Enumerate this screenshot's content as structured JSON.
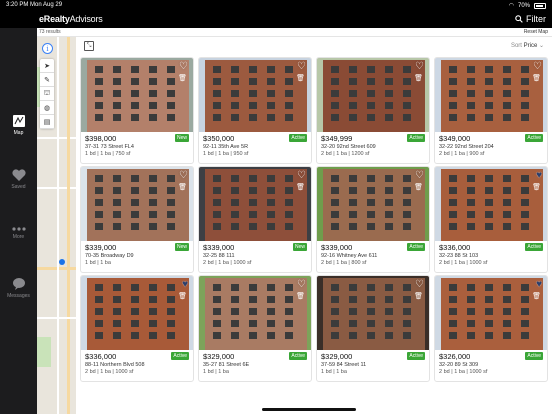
{
  "status": {
    "time": "3:20 PM",
    "date": "Mon Aug 29",
    "battery": "70%"
  },
  "header": {
    "logo_brand": "eRealty",
    "logo_rest": "Advisors",
    "filter_label": "Filter"
  },
  "rail": [
    {
      "label": "Map",
      "icon": "map-icon",
      "active": true
    },
    {
      "label": "Saved",
      "icon": "heart-icon",
      "active": false
    },
    {
      "label": "More",
      "icon": "more-dots-icon",
      "active": false
    },
    {
      "label": "Messages",
      "icon": "chat-bubble-icon",
      "active": false
    }
  ],
  "subheader": {
    "results": "73 results",
    "reset": "Reset Map"
  },
  "sort": {
    "label": "Sort",
    "value": "Price"
  },
  "listings": [
    {
      "price": "$398,000",
      "address": "37-31 73 Street FL4",
      "specs": "1 bd | 1 ba | 750 sf",
      "badge": "New",
      "saved": false
    },
    {
      "price": "$350,000",
      "address": "92-11 35th Ave 5R",
      "specs": "1 bd | 1 ba | 950 sf",
      "badge": "Active",
      "saved": false
    },
    {
      "price": "$349,999",
      "address": "32-20 92nd Street 609",
      "specs": "2 bd | 1 ba | 1200 sf",
      "badge": "Active",
      "saved": false
    },
    {
      "price": "$349,000",
      "address": "32-22 92nd Street 204",
      "specs": "2 bd | 1 ba | 900 sf",
      "badge": "Active",
      "saved": false
    },
    {
      "price": "$339,000",
      "address": "70-35 Broadway D9",
      "specs": "1 bd | 1 ba",
      "badge": "New",
      "saved": false
    },
    {
      "price": "$339,000",
      "address": "32-25 88 111",
      "specs": "2 bd | 1 ba | 1000 sf",
      "badge": "New",
      "saved": false
    },
    {
      "price": "$339,000",
      "address": "92-16 Whitney Ave 611",
      "specs": "2 bd | 1 ba | 800 sf",
      "badge": "Active",
      "saved": false
    },
    {
      "price": "$336,000",
      "address": "32-23 88 St 103",
      "specs": "2 bd | 1 ba | 1000 sf",
      "badge": "Active",
      "saved": true
    },
    {
      "price": "$336,000",
      "address": "88-11 Northern Blvd 508",
      "specs": "2 bd | 1 ba | 1000 sf",
      "badge": "Active",
      "saved": true
    },
    {
      "price": "$329,000",
      "address": "35-27 81 Street 6E",
      "specs": "1 bd | 1 ba",
      "badge": "Active",
      "saved": false
    },
    {
      "price": "$329,000",
      "address": "37-59 84 Street 11",
      "specs": "1 bd | 1 ba",
      "badge": "Active",
      "saved": false
    },
    {
      "price": "$326,000",
      "address": "32-20 89 St 309",
      "specs": "2 bd | 1 ba | 1000 sf",
      "badge": "Active",
      "saved": true
    }
  ],
  "colors": {
    "badge": "#3aa637",
    "saved_heart": "#2d3f6b",
    "brick": "#a0573a"
  }
}
